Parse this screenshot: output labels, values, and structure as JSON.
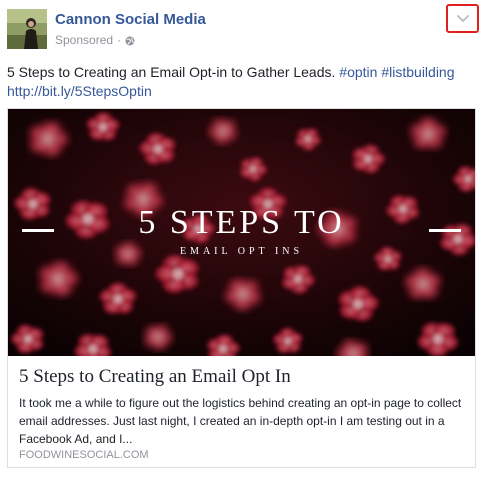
{
  "post": {
    "page_name": "Cannon Social Media",
    "sponsored_label": "Sponsored",
    "separator": "·",
    "privacy_icon": "globe-icon",
    "menu_icon": "chevron-down-icon",
    "menu_highlight_color": "#e0201f",
    "text": "5 Steps to Creating an Email Opt-in to Gather Leads.",
    "hashtags": [
      "#optin",
      "#listbuilding"
    ],
    "url": "http://bit.ly/5StepsOptin"
  },
  "link_card": {
    "image_title": "5 STEPS TO",
    "image_subtitle": "EMAIL OPT INS",
    "title": "5 Steps to Creating an Email Opt In",
    "description": "It took me a while to figure out the logistics behind creating an opt-in page to collect email addresses. Just last night, I created an in-depth opt-in I am testing out in a Facebook Ad, and I...",
    "domain": "FOODWINESOCIAL.COM"
  },
  "colors": {
    "link": "#365899",
    "meta": "#90949c",
    "text": "#1d2129",
    "flower": "#e8334f"
  }
}
